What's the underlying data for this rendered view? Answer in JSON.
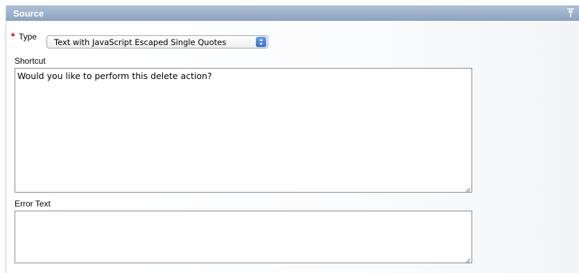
{
  "region": {
    "title": "Source",
    "collapse_icon": "collapse-up-icon"
  },
  "type_field": {
    "required_marker": "*",
    "label": "Type",
    "selected_value": "Text with JavaScript Escaped Single Quotes"
  },
  "shortcut_field": {
    "label": "Shortcut",
    "value": "Would you like to perform this delete action?"
  },
  "error_text_field": {
    "label": "Error Text",
    "value": ""
  },
  "colors": {
    "header_top": "#aebfd6",
    "header_bottom": "#8ea4c3",
    "required": "#cc0000",
    "select_arrow": "#2f6fd6"
  }
}
